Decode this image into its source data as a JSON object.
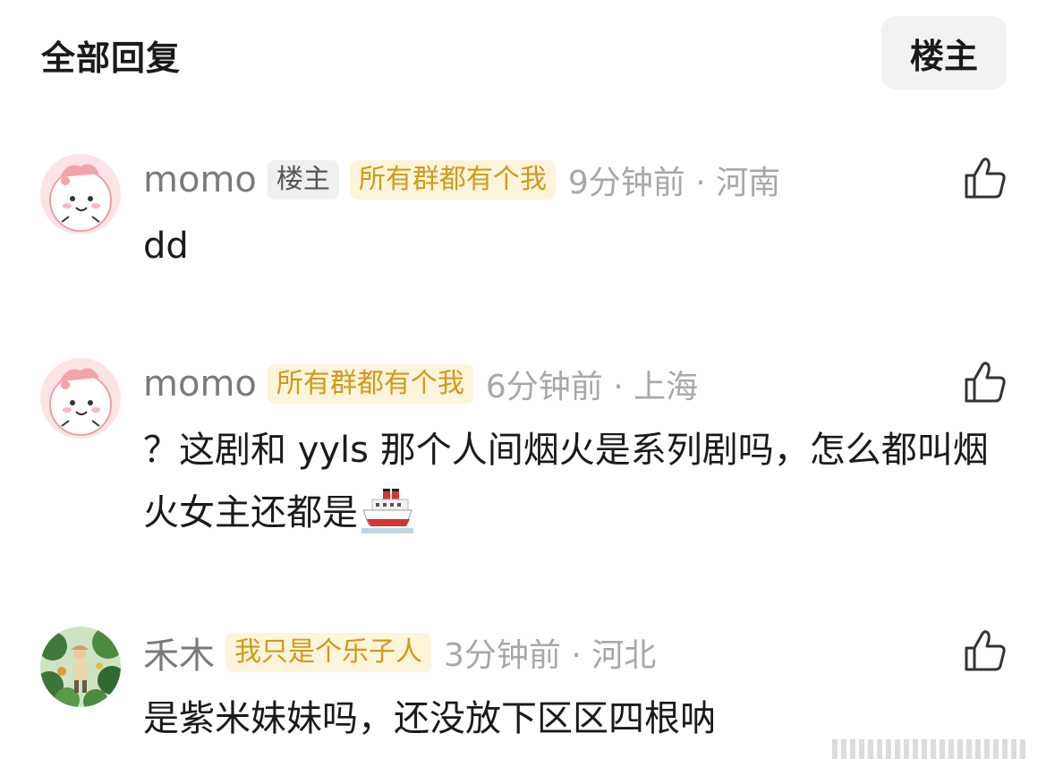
{
  "header": {
    "title": "全部回复",
    "filter_label": "楼主"
  },
  "comments": [
    {
      "username": "momo",
      "op_tag": "楼主",
      "badge": "所有群都有个我",
      "time_location": "9分钟前 · 河南",
      "text": "dd"
    },
    {
      "username": "momo",
      "badge": "所有群都有个我",
      "time_location": "6分钟前 · 上海",
      "text": "？这剧和 yyls 那个人间烟火是系列剧吗，怎么都叫烟火女主还都是"
    },
    {
      "username": "禾木",
      "badge": "我只是个乐子人",
      "time_location": "3分钟前 · 河北",
      "text": "是紫米妹妹吗，还没放下区区四根呐"
    }
  ],
  "icons": {
    "like": "thumbs-up-icon",
    "ship_emoji": "ship-icon",
    "avatar_pink": "pink-cartoon-avatar",
    "avatar_green": "garden-figure-avatar"
  },
  "colors": {
    "badge_text": "#d19a16",
    "badge_bg": "#fdf4dc",
    "meta_gray": "#a8a8a8",
    "username_gray": "#7a7a7a"
  }
}
